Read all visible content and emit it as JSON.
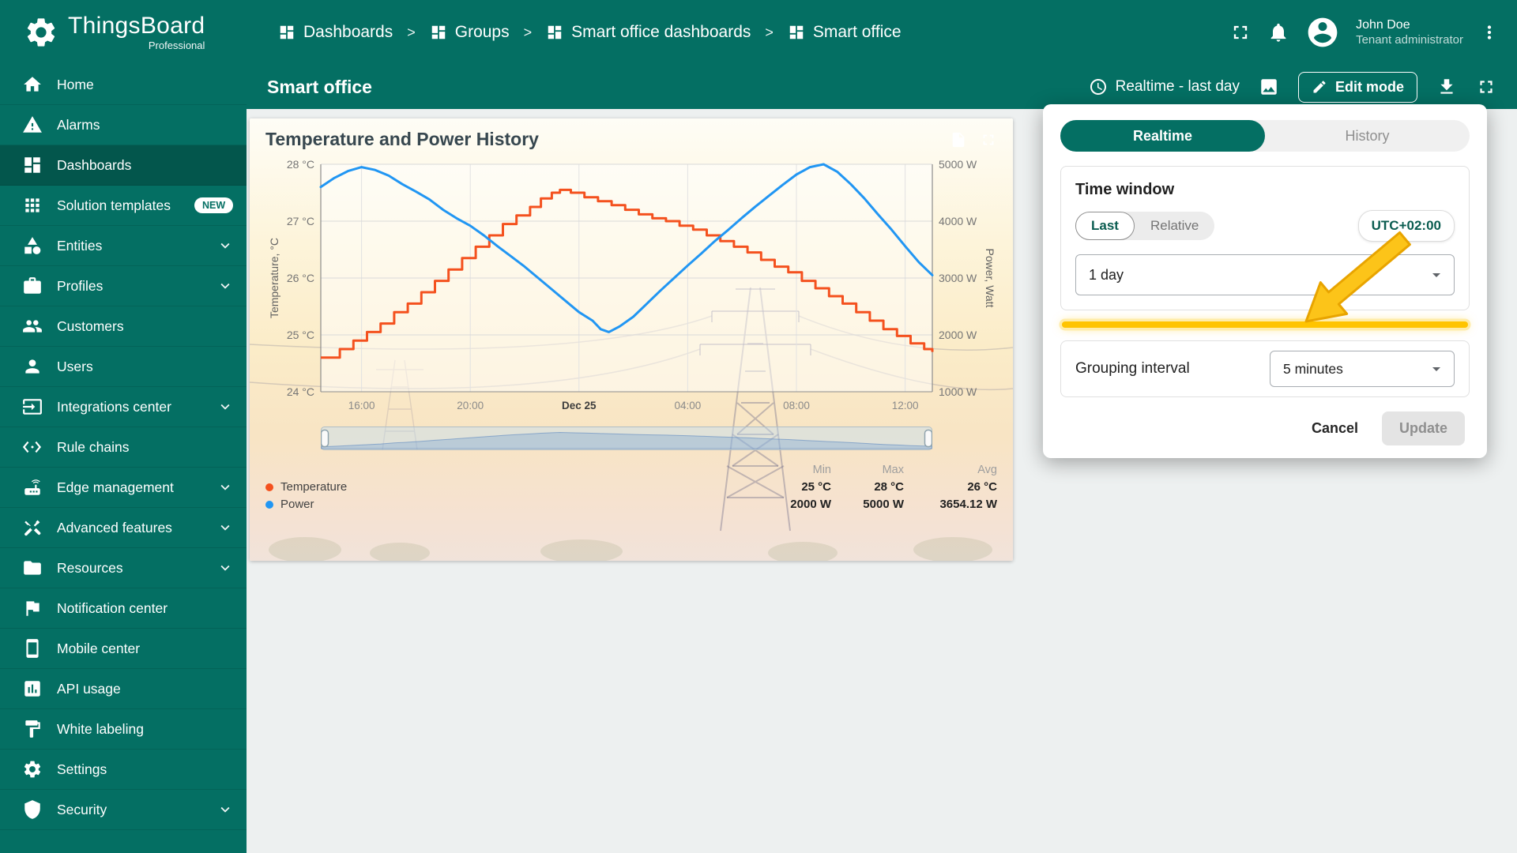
{
  "app": {
    "brand": "ThingsBoard",
    "brand_sub": "Professional"
  },
  "topbar": {
    "breadcrumb": [
      {
        "label": "Dashboards"
      },
      {
        "label": "Groups"
      },
      {
        "label": "Smart office dashboards"
      },
      {
        "label": "Smart office"
      }
    ],
    "separator": ">",
    "user": {
      "name": "John Doe",
      "role": "Tenant administrator"
    }
  },
  "sidebar": {
    "items": [
      {
        "label": "Home",
        "icon": "home"
      },
      {
        "label": "Alarms",
        "icon": "warning"
      },
      {
        "label": "Dashboards",
        "icon": "dashboards",
        "active": true
      },
      {
        "label": "Solution templates",
        "icon": "apps",
        "badge": "NEW"
      },
      {
        "label": "Entities",
        "icon": "entities",
        "expandable": true
      },
      {
        "label": "Profiles",
        "icon": "briefcase",
        "expandable": true
      },
      {
        "label": "Customers",
        "icon": "people"
      },
      {
        "label": "Users",
        "icon": "person"
      },
      {
        "label": "Integrations center",
        "icon": "input",
        "expandable": true
      },
      {
        "label": "Rule chains",
        "icon": "rulechain"
      },
      {
        "label": "Edge management",
        "icon": "edge",
        "expandable": true
      },
      {
        "label": "Advanced features",
        "icon": "tools",
        "expandable": true
      },
      {
        "label": "Resources",
        "icon": "folder",
        "expandable": true
      },
      {
        "label": "Notification center",
        "icon": "flag"
      },
      {
        "label": "Mobile center",
        "icon": "mobile"
      },
      {
        "label": "API usage",
        "icon": "apiusage"
      },
      {
        "label": "White labeling",
        "icon": "paint"
      },
      {
        "label": "Settings",
        "icon": "gear"
      },
      {
        "label": "Security",
        "icon": "shield",
        "expandable": true
      }
    ]
  },
  "toolbar": {
    "title": "Smart office",
    "timewindow": "Realtime - last day",
    "edit_mode": "Edit mode"
  },
  "widget": {
    "title": "Temperature and Power History",
    "legend": {
      "headers": [
        "Min",
        "Max",
        "Avg"
      ],
      "rows": [
        {
          "name": "Temperature",
          "color": "#f4511e",
          "values": [
            "25 °C",
            "28 °C",
            "26 °C"
          ]
        },
        {
          "name": "Power",
          "color": "#2196f3",
          "values": [
            "2000 W",
            "5000 W",
            "3654.12 W"
          ]
        }
      ]
    }
  },
  "popup": {
    "tabs": [
      {
        "label": "Realtime",
        "active": true
      },
      {
        "label": "History",
        "active": false
      }
    ],
    "time_window_title": "Time window",
    "last": "Last",
    "relative": "Relative",
    "timezone": "UTC+02:00",
    "interval": "1 day",
    "grouping_label": "Grouping interval",
    "grouping_value": "5 minutes",
    "cancel": "Cancel",
    "update": "Update"
  },
  "chart_data": {
    "type": "line",
    "title": "Temperature and Power History",
    "x_range": [
      0,
      22.5
    ],
    "x_ticks": [
      {
        "t": 1.5,
        "label": "16:00"
      },
      {
        "t": 5.5,
        "label": "20:00"
      },
      {
        "t": 9.5,
        "label": "Dec 25",
        "emphasis": true
      },
      {
        "t": 13.5,
        "label": "04:00"
      },
      {
        "t": 17.5,
        "label": "08:00"
      },
      {
        "t": 21.5,
        "label": "12:00"
      }
    ],
    "left_axis": {
      "label": "Temperature, °C",
      "unit": "°C",
      "range": [
        24,
        28
      ],
      "ticks": [
        28,
        27,
        26,
        25,
        24
      ]
    },
    "right_axis": {
      "label": "Power, Watt",
      "unit": "W",
      "range": [
        1000,
        5000
      ],
      "ticks": [
        5000,
        4000,
        3000,
        2000,
        1000
      ]
    },
    "series": [
      {
        "name": "Temperature",
        "axis": "left",
        "style": "step",
        "color": "#f4511e",
        "stats": {
          "min": 25,
          "max": 28,
          "avg": 26
        },
        "points": [
          [
            0,
            24.6
          ],
          [
            0.7,
            24.75
          ],
          [
            1.2,
            24.9
          ],
          [
            1.7,
            25.05
          ],
          [
            2.2,
            25.2
          ],
          [
            2.7,
            25.4
          ],
          [
            3.2,
            25.55
          ],
          [
            3.7,
            25.75
          ],
          [
            4.2,
            25.95
          ],
          [
            4.7,
            26.15
          ],
          [
            5.2,
            26.35
          ],
          [
            5.7,
            26.55
          ],
          [
            6.2,
            26.75
          ],
          [
            6.7,
            26.95
          ],
          [
            7.2,
            27.1
          ],
          [
            7.7,
            27.25
          ],
          [
            8.1,
            27.4
          ],
          [
            8.5,
            27.5
          ],
          [
            8.8,
            27.55
          ],
          [
            9.2,
            27.5
          ],
          [
            9.7,
            27.42
          ],
          [
            10.2,
            27.35
          ],
          [
            10.7,
            27.28
          ],
          [
            11.2,
            27.2
          ],
          [
            11.7,
            27.12
          ],
          [
            12.2,
            27.05
          ],
          [
            12.7,
            27.0
          ],
          [
            13.2,
            26.92
          ],
          [
            13.7,
            26.85
          ],
          [
            14.2,
            26.75
          ],
          [
            14.7,
            26.65
          ],
          [
            15.2,
            26.55
          ],
          [
            15.7,
            26.45
          ],
          [
            16.2,
            26.32
          ],
          [
            16.7,
            26.2
          ],
          [
            17.2,
            26.1
          ],
          [
            17.7,
            25.95
          ],
          [
            18.2,
            25.82
          ],
          [
            18.7,
            25.68
          ],
          [
            19.2,
            25.55
          ],
          [
            19.7,
            25.4
          ],
          [
            20.2,
            25.25
          ],
          [
            20.7,
            25.1
          ],
          [
            21.2,
            24.98
          ],
          [
            21.7,
            24.85
          ],
          [
            22.2,
            24.75
          ],
          [
            22.5,
            24.7
          ]
        ]
      },
      {
        "name": "Power",
        "axis": "right",
        "style": "line",
        "color": "#2196f3",
        "stats": {
          "min": 2000,
          "max": 5000,
          "avg": 3654.12
        },
        "points": [
          [
            0,
            4600
          ],
          [
            0.5,
            4760
          ],
          [
            1,
            4880
          ],
          [
            1.5,
            4950
          ],
          [
            2,
            4900
          ],
          [
            2.5,
            4800
          ],
          [
            3,
            4650
          ],
          [
            3.5,
            4520
          ],
          [
            4,
            4380
          ],
          [
            4.5,
            4200
          ],
          [
            5,
            4050
          ],
          [
            5.5,
            3920
          ],
          [
            6,
            3750
          ],
          [
            6.5,
            3560
          ],
          [
            7,
            3380
          ],
          [
            7.5,
            3200
          ],
          [
            8,
            3000
          ],
          [
            8.5,
            2800
          ],
          [
            9,
            2600
          ],
          [
            9.5,
            2400
          ],
          [
            10,
            2250
          ],
          [
            10.3,
            2100
          ],
          [
            10.6,
            2050
          ],
          [
            11,
            2150
          ],
          [
            11.5,
            2320
          ],
          [
            12,
            2550
          ],
          [
            12.5,
            2780
          ],
          [
            13,
            3000
          ],
          [
            13.5,
            3220
          ],
          [
            14,
            3430
          ],
          [
            14.5,
            3650
          ],
          [
            15,
            3850
          ],
          [
            15.5,
            4060
          ],
          [
            16,
            4260
          ],
          [
            16.5,
            4450
          ],
          [
            17,
            4640
          ],
          [
            17.5,
            4820
          ],
          [
            18,
            4950
          ],
          [
            18.5,
            5000
          ],
          [
            19,
            4870
          ],
          [
            19.5,
            4650
          ],
          [
            20,
            4400
          ],
          [
            20.5,
            4120
          ],
          [
            21,
            3850
          ],
          [
            21.5,
            3560
          ],
          [
            22,
            3280
          ],
          [
            22.5,
            3050
          ]
        ]
      }
    ]
  }
}
